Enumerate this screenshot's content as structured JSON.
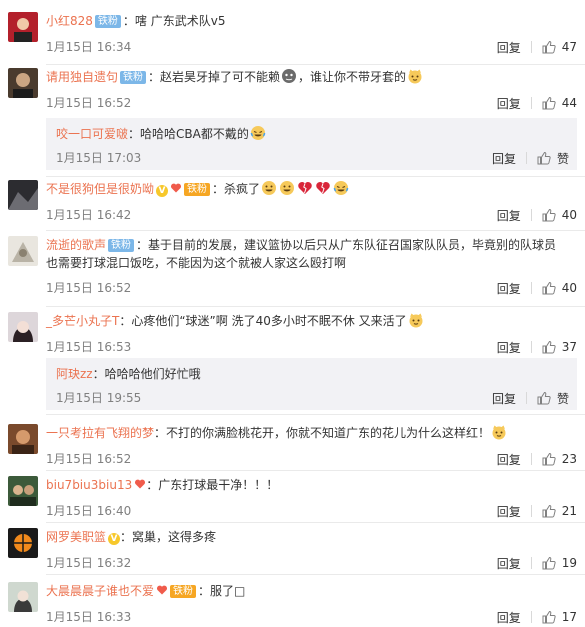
{
  "labels": {
    "reply": "回复",
    "like": "赞"
  },
  "comments": [
    {
      "user": "小红828",
      "badge": "铁粉",
      "text": "：嗐 广东武术队v5",
      "time": "1月15日 16:34",
      "likes": "47"
    },
    {
      "user": "请用独自遗句",
      "badge": "铁粉",
      "text": "：赵岩昊牙掉了可不能赖",
      "text2": "，谁让你不带牙套的",
      "time": "1月15日 16:52",
      "likes": "44",
      "reply": {
        "user": "咬一口可爱啵",
        "text": "：哈哈哈CBA都不戴的",
        "time": "1月15日 17:03"
      }
    },
    {
      "user": "不是很狗但是很奶呦",
      "badge": "铁粉",
      "text": "：杀疯了",
      "time": "1月15日 16:42",
      "likes": "40"
    },
    {
      "user": "流逝的歌声",
      "badge": "铁粉",
      "text": "：基于目前的发展，建议篮协以后只从广东队征召国家队队员，毕竟别的队球员",
      "text_line2": "也需要打球混口饭吃，不能因为这个就被人家这么殴打啊",
      "time": "1月15日 16:52",
      "likes": "40"
    },
    {
      "user": "_多芒小丸子T",
      "text": "：心疼他们“球迷”啊 洗了40多小时不眠不休 又来活了",
      "time": "1月15日 16:53",
      "likes": "37",
      "reply": {
        "user": "阿玦zz",
        "text": "：哈哈哈他们好忙哦",
        "time": "1月15日 19:55"
      }
    },
    {
      "user": "一只考拉有飞翔的梦",
      "text": "：不打的你满脸桃花开，你就不知道广东的花儿为什么这样红！",
      "time": "1月15日 16:52",
      "likes": "23"
    },
    {
      "user": "biu7biu3biu13",
      "text": "：广东打球最干净！！！",
      "time": "1月15日 16:40",
      "likes": "21"
    },
    {
      "user": "网罗美职篮",
      "text": "：窝巢，这得多疼",
      "time": "1月15日 16:32",
      "likes": "19"
    },
    {
      "user": "大晨晨晨子谁也不爱",
      "badge": "铁粉",
      "text": "：服了□",
      "time": "1月15日 16:33",
      "likes": "17"
    }
  ],
  "colors": {
    "username": "#eb7350",
    "badge": "#7cb7e8",
    "badge_gold": "#f6a623",
    "time": "#808080",
    "reply_bg": "#f2f2f5"
  }
}
